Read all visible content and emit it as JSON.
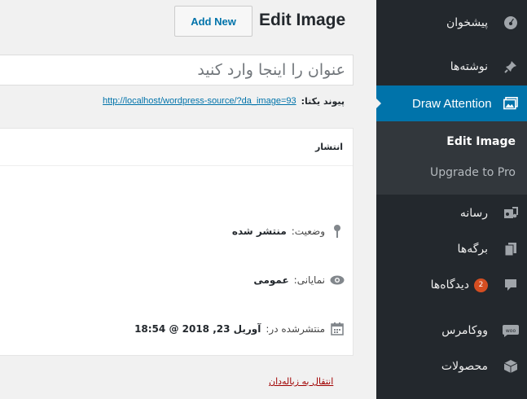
{
  "header": {
    "title": "Edit Image",
    "add_new_label": "Add New"
  },
  "editor": {
    "title_placeholder": "عنوان را اینجا وارد کنید",
    "permalink_label": "پیوند یکتا:",
    "permalink_url": "http://localhost/wordpress-source/?da_image=93"
  },
  "publish": {
    "heading": "انتشار",
    "status_label": "وضعیت:",
    "status_value": "منتشر شده",
    "visibility_label": "نمایانی:",
    "visibility_value": "عمومی",
    "published_label": "منتشرشده در:",
    "published_value": "آوریل 23, 2018 @ 18:54",
    "trash_label": "انتقال به زباله‌دان"
  },
  "sidebar": {
    "dashboard": "پیشخوان",
    "posts": "نوشته‌ها",
    "draw_attention": "Draw Attention",
    "sub_edit_image": "Edit Image",
    "sub_upgrade": "Upgrade to Pro",
    "media": "رسانه",
    "pages": "برگه‌ها",
    "comments": "دیدگاه‌ها",
    "comments_badge": "2",
    "woocommerce": "ووکامرس",
    "products": "محصولات"
  },
  "colors": {
    "sidebar_bg": "#23282d",
    "active_bg": "#0073aa",
    "badge": "#d54e21",
    "link": "#0073aa"
  }
}
